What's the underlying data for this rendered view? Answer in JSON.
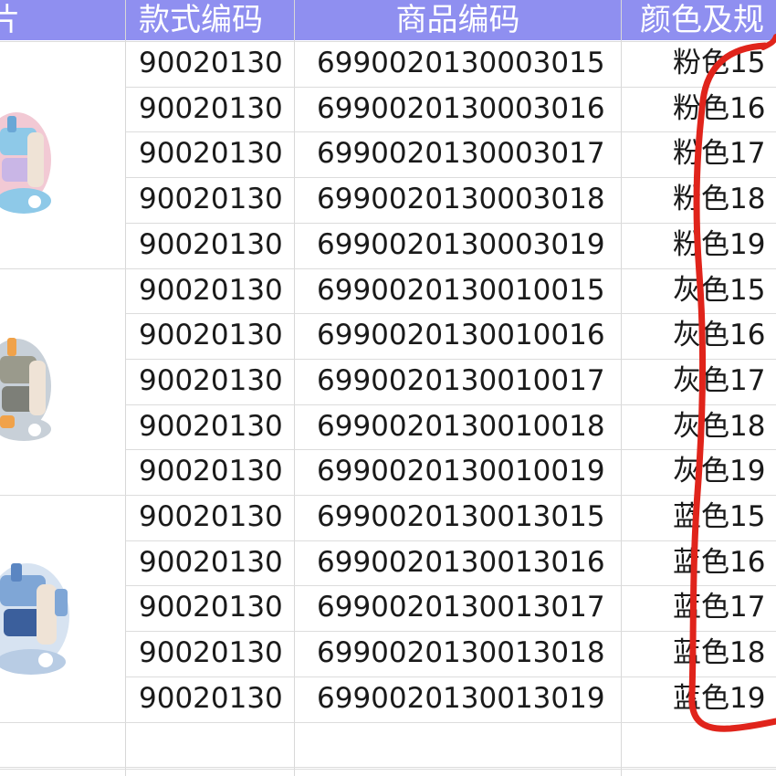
{
  "header": {
    "col_image_label": "片",
    "col_style_code": "款式编码",
    "col_product_code": "商品编码",
    "col_color_spec": "颜色及规"
  },
  "rows": [
    {
      "style": "90020130",
      "code": "6990020130003015",
      "spec": "粉色15"
    },
    {
      "style": "90020130",
      "code": "6990020130003016",
      "spec": "粉色16"
    },
    {
      "style": "90020130",
      "code": "6990020130003017",
      "spec": "粉色17"
    },
    {
      "style": "90020130",
      "code": "6990020130003018",
      "spec": "粉色18"
    },
    {
      "style": "90020130",
      "code": "6990020130003019",
      "spec": "粉色19"
    },
    {
      "style": "90020130",
      "code": "6990020130010015",
      "spec": "灰色15"
    },
    {
      "style": "90020130",
      "code": "6990020130010016",
      "spec": "灰色16"
    },
    {
      "style": "90020130",
      "code": "6990020130010017",
      "spec": "灰色17"
    },
    {
      "style": "90020130",
      "code": "6990020130010018",
      "spec": "灰色18"
    },
    {
      "style": "90020130",
      "code": "6990020130010019",
      "spec": "灰色19"
    },
    {
      "style": "90020130",
      "code": "6990020130013015",
      "spec": "蓝色15"
    },
    {
      "style": "90020130",
      "code": "6990020130013016",
      "spec": "蓝色16"
    },
    {
      "style": "90020130",
      "code": "6990020130013017",
      "spec": "蓝色17"
    },
    {
      "style": "90020130",
      "code": "6990020130013018",
      "spec": "蓝色18"
    },
    {
      "style": "90020130",
      "code": "6990020130013019",
      "spec": "蓝色19"
    }
  ],
  "images": [
    {
      "name": "pink-sandal-image",
      "colors": [
        "#f2c9d4",
        "#8ec9e8",
        "#c9b6e6",
        "#ffffff"
      ]
    },
    {
      "name": "gray-sandal-image",
      "colors": [
        "#9a9a8c",
        "#f0a24a",
        "#c8d0d8",
        "#ffffff"
      ]
    },
    {
      "name": "blue-sandal-image",
      "colors": [
        "#7fa6d6",
        "#3b5f9c",
        "#d7e3f1",
        "#ffffff"
      ]
    }
  ],
  "colors": {
    "header_bg": "#8f8ff0",
    "header_text": "#ffffff",
    "annotation": "#e0241b"
  }
}
